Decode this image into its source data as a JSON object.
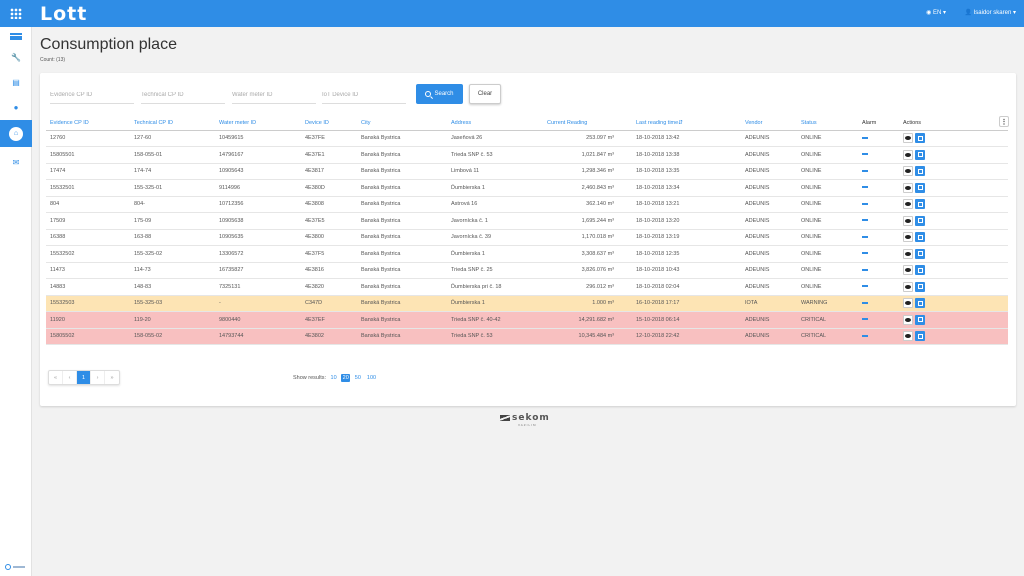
{
  "app": {
    "logo": "Lott"
  },
  "topbar": {
    "language": "◉ EN ▾",
    "user": "👤 Isaidor skaren ▾"
  },
  "page": {
    "title": "Consumption place",
    "count": "Count: (13)"
  },
  "filters": {
    "evidence_placeholder": "Evidence CP ID",
    "technical_placeholder": "Technical CP ID",
    "meter_placeholder": "Water meter ID",
    "iot_placeholder": "IoT Device ID",
    "search_label": "Search",
    "clear_label": "Clear"
  },
  "table": {
    "columns": [
      "Evidence CP ID",
      "Technical CP ID",
      "Water meter ID",
      "Device ID",
      "City",
      "Address",
      "Current Reading",
      "Last reading time⇵",
      "Vendor",
      "Status",
      "Alarm",
      "Actions"
    ],
    "column_menu": "⋮",
    "rows": [
      {
        "evidence": "12760",
        "technical": "127-60",
        "meter": "10459615",
        "device": "4E37FE",
        "city": "Banská Bystrica",
        "address": "Jaseňová 26",
        "reading": "253.097 m³",
        "time": "18-10-2018 13:42",
        "vendor": "ADEUNIS",
        "status": "ONLINE",
        "state": "normal"
      },
      {
        "evidence": "15805501",
        "technical": "158-055-01",
        "meter": "14796167",
        "device": "4E37E1",
        "city": "Banská Bystrica",
        "address": "Trieda SNP č. 53",
        "reading": "1,021.847 m³",
        "time": "18-10-2018 13:38",
        "vendor": "ADEUNIS",
        "status": "ONLINE",
        "state": "normal"
      },
      {
        "evidence": "17474",
        "technical": "174-74",
        "meter": "10905643",
        "device": "4E3817",
        "city": "Banská Bystrica",
        "address": "Limbová 11",
        "reading": "1,298.346 m³",
        "time": "18-10-2018 13:35",
        "vendor": "ADEUNIS",
        "status": "ONLINE",
        "state": "normal"
      },
      {
        "evidence": "15532501",
        "technical": "155-325-01",
        "meter": "9114996",
        "device": "4E380D",
        "city": "Banská Bystrica",
        "address": "Ďumbierska 1",
        "reading": "2,460.843 m³",
        "time": "18-10-2018 13:34",
        "vendor": "ADEUNIS",
        "status": "ONLINE",
        "state": "normal"
      },
      {
        "evidence": "804",
        "technical": "804-",
        "meter": "10712356",
        "device": "4E3808",
        "city": "Banská Bystrica",
        "address": "Astrová 16",
        "reading": "362.140 m³",
        "time": "18-10-2018 13:21",
        "vendor": "ADEUNIS",
        "status": "ONLINE",
        "state": "normal"
      },
      {
        "evidence": "17509",
        "technical": "175-09",
        "meter": "10905638",
        "device": "4E37E5",
        "city": "Banská Bystrica",
        "address": "Javornícka č. 1",
        "reading": "1,695.244 m³",
        "time": "18-10-2018 13:20",
        "vendor": "ADEUNIS",
        "status": "ONLINE",
        "state": "normal"
      },
      {
        "evidence": "16388",
        "technical": "163-88",
        "meter": "10905635",
        "device": "4E3800",
        "city": "Banská Bystrica",
        "address": "Javornícka č. 39",
        "reading": "1,170.018 m³",
        "time": "18-10-2018 13:19",
        "vendor": "ADEUNIS",
        "status": "ONLINE",
        "state": "normal"
      },
      {
        "evidence": "15532502",
        "technical": "155-325-02",
        "meter": "13306572",
        "device": "4E37F5",
        "city": "Banská Bystrica",
        "address": "Ďumbierska 1",
        "reading": "3,308.637 m³",
        "time": "18-10-2018 12:35",
        "vendor": "ADEUNIS",
        "status": "ONLINE",
        "state": "normal"
      },
      {
        "evidence": "11473",
        "technical": "114-73",
        "meter": "16735827",
        "device": "4E3816",
        "city": "Banská Bystrica",
        "address": "Trieda SNP č. 25",
        "reading": "3,826.076 m³",
        "time": "18-10-2018 10:43",
        "vendor": "ADEUNIS",
        "status": "ONLINE",
        "state": "normal"
      },
      {
        "evidence": "14883",
        "technical": "148-83",
        "meter": "7325131",
        "device": "4E3820",
        "city": "Banská Bystrica",
        "address": "Ďumbierska pri č. 18",
        "reading": "296.012 m³",
        "time": "18-10-2018 02:04",
        "vendor": "ADEUNIS",
        "status": "ONLINE",
        "state": "normal"
      },
      {
        "evidence": "15532503",
        "technical": "155-325-03",
        "meter": "-",
        "device": "C347D",
        "city": "Banská Bystrica",
        "address": "Ďumbierska 1",
        "reading": "1.000 m³",
        "time": "16-10-2018 17:17",
        "vendor": "IOTA",
        "status": "WARNING",
        "state": "warning"
      },
      {
        "evidence": "11920",
        "technical": "119-20",
        "meter": "9800440",
        "device": "4E37EF",
        "city": "Banská Bystrica",
        "address": "Trieda SNP č. 40-42",
        "reading": "14,291.682 m³",
        "time": "15-10-2018 06:14",
        "vendor": "ADEUNIS",
        "status": "CRITICAL",
        "state": "critical"
      },
      {
        "evidence": "15805502",
        "technical": "158-055-02",
        "meter": "14793744",
        "device": "4E3802",
        "city": "Banská Bystrica",
        "address": "Trieda SNP č. 53",
        "reading": "10,345.484 m³",
        "time": "12-10-2018 22:42",
        "vendor": "ADEUNIS",
        "status": "CRITICAL",
        "state": "critical"
      }
    ]
  },
  "pagination": {
    "first": "«",
    "prev": "‹",
    "current": "1",
    "next": "›",
    "last": "»"
  },
  "results": {
    "label": "Show results:",
    "options": [
      "10",
      "20",
      "50",
      "100"
    ],
    "selected": "20"
  },
  "footer": {
    "brand": "sekom",
    "sub": "VAZILIM"
  },
  "colors": {
    "accent": "#2f8de6",
    "warning_row": "#fde4b4",
    "critical_row": "#f8c0c0"
  }
}
